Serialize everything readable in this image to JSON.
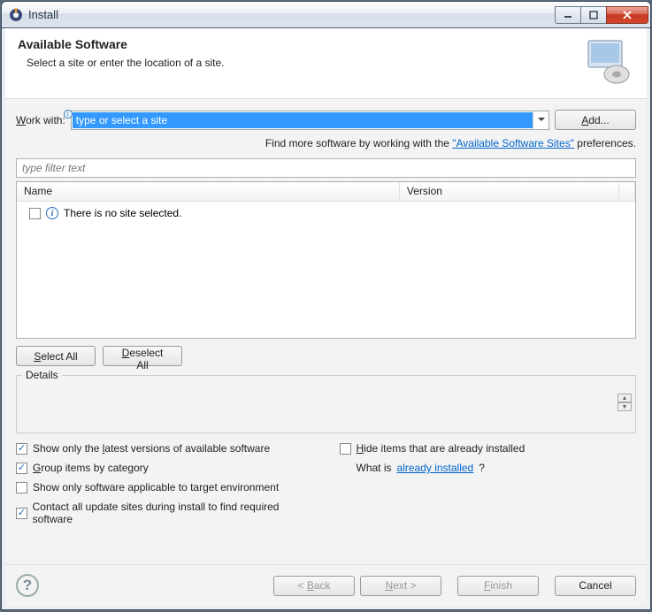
{
  "titlebar": {
    "title": "Install"
  },
  "header": {
    "title": "Available Software",
    "subtitle": "Select a site or enter the location of a site."
  },
  "workwith": {
    "label_pre": "W",
    "label_post": "ork with:",
    "placeholder": "type or select a site",
    "add_btn_pre": "A",
    "add_btn_post": "dd..."
  },
  "hint": {
    "pre": "Find more software by working with the ",
    "link": "\"Available Software Sites\"",
    "post": " preferences."
  },
  "filter": {
    "placeholder": "type filter text"
  },
  "tree": {
    "col_name": "Name",
    "col_version": "Version",
    "empty_msg": "There is no site selected."
  },
  "buttons": {
    "select_all_pre": "S",
    "select_all_post": "elect All",
    "deselect_all_pre": "D",
    "deselect_all_post": "eselect All",
    "back_pre": "< ",
    "back_u": "B",
    "back_post": "ack",
    "next_pre": "N",
    "next_post": "ext >",
    "finish_pre": "F",
    "finish_post": "inish",
    "cancel": "Cancel"
  },
  "details": {
    "label": "Details"
  },
  "options": {
    "latest_pre": "Show only the ",
    "latest_u": "l",
    "latest_post": "atest versions of available software",
    "group_pre": "G",
    "group_post": "roup items by category",
    "target": "Show only software applicable to target environment",
    "contact": "Contact all update sites during install to find required software",
    "hide_pre": "H",
    "hide_post": "ide items that are already installed",
    "what_pre": "What is ",
    "what_link": "already installed",
    "what_post": "?"
  }
}
